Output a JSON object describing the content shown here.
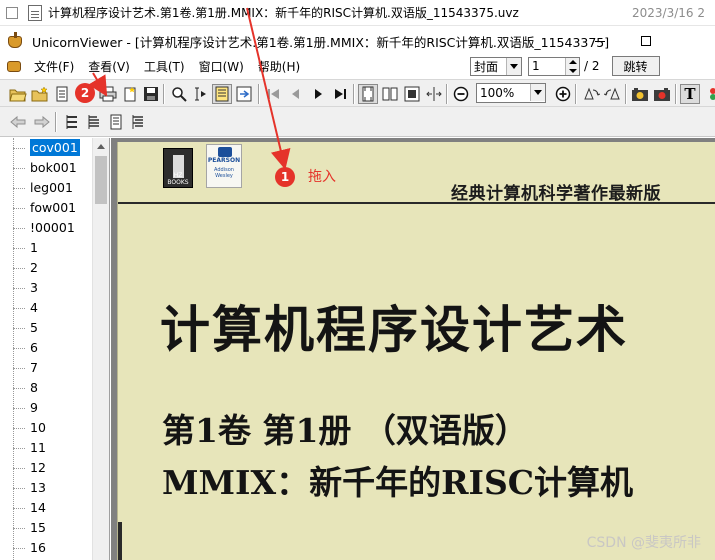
{
  "file_row": {
    "filename": "计算机程序设计艺术.第1卷.第1册.MMIX：新千年的RISC计算机.双语版_11543375.uvz",
    "date": "2023/3/16 2"
  },
  "window": {
    "title": "UnicornViewer - [计算机程序设计艺术.第1卷.第1册.MMIX：新千年的RISC计算机.双语版_11543375]"
  },
  "menu": {
    "items": [
      "文件(F)",
      "查看(V)",
      "工具(T)",
      "窗口(W)",
      "帮助(H)"
    ]
  },
  "page_control": {
    "section": "封面",
    "current_page": "1",
    "total": "/ 2",
    "jump_label": "跳转"
  },
  "toolbar": {
    "zoom": "100%",
    "text_tool": "T"
  },
  "tree": {
    "selected": "cov001",
    "items": [
      "cov001",
      "bok001",
      "leg001",
      "fow001",
      "!00001",
      "1",
      "2",
      "3",
      "4",
      "5",
      "6",
      "7",
      "8",
      "9",
      "10",
      "11",
      "12",
      "13",
      "14",
      "15",
      "16"
    ]
  },
  "book_page": {
    "logo_left": "HZ BOOKS",
    "logo_right_top": "PEARSON",
    "logo_right_bottom": "Addison Wesley",
    "series": "经典计算机科学著作最新版",
    "title": "计算机程序设计艺术",
    "subtitle_1": "第1卷  第1册  （双语版）",
    "subtitle_2": "MMIX：新千年的RISC计算机"
  },
  "annotations": {
    "badge_1": "1",
    "badge_2": "2",
    "drag_label": "拖入",
    "color": "#e5332a"
  },
  "watermark": "CSDN @斐夷所非"
}
